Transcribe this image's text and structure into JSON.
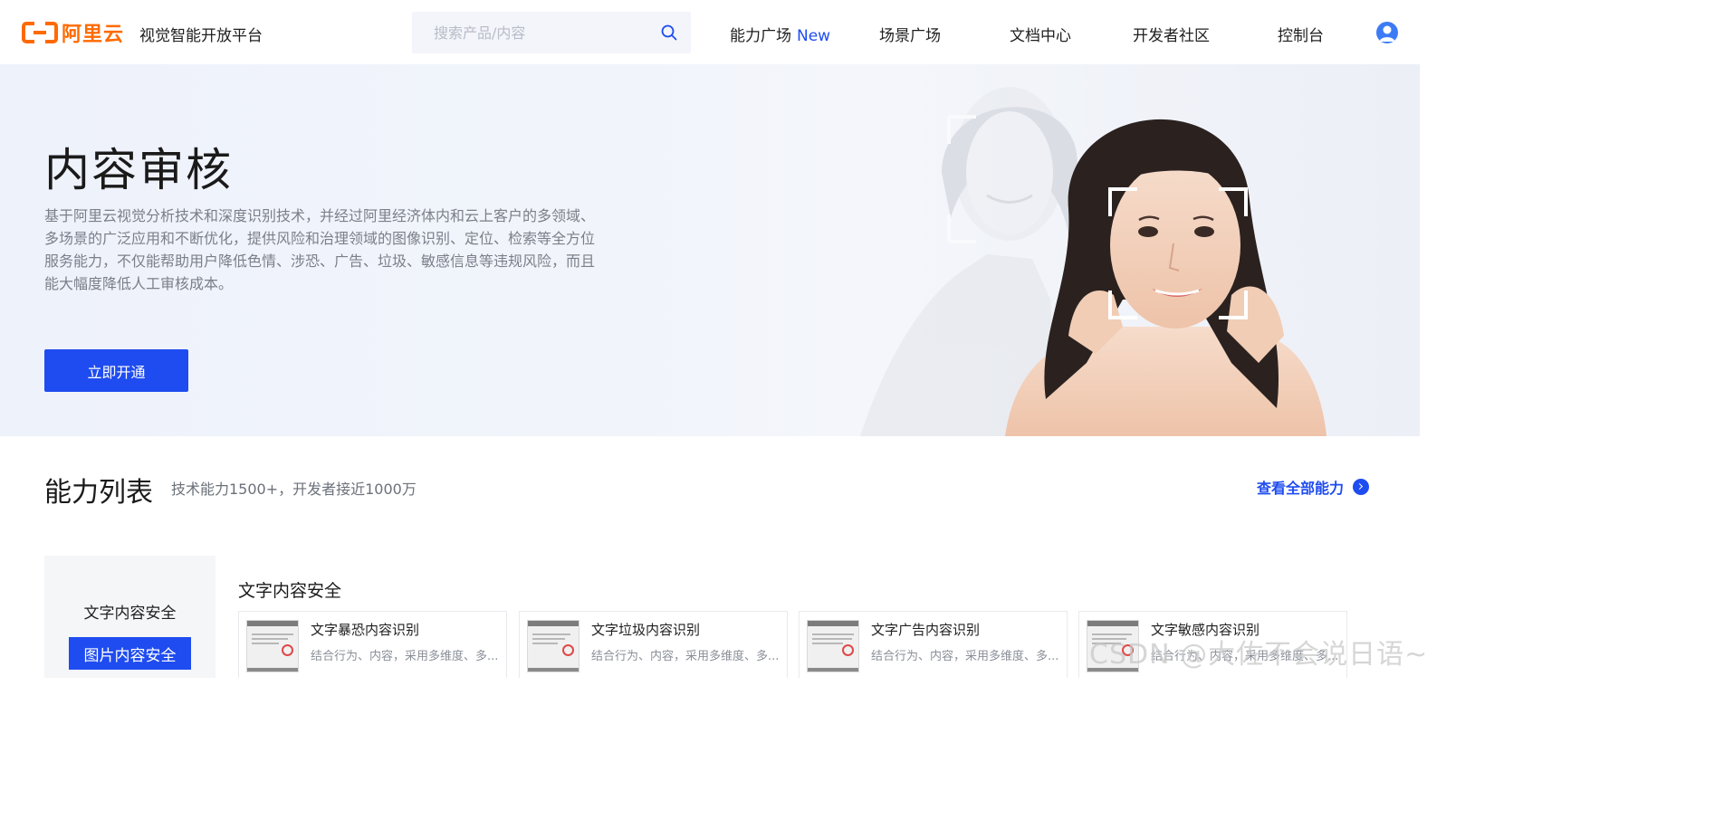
{
  "header": {
    "logo_text": "阿里云",
    "platform_name": "视觉智能开放平台",
    "search_placeholder": "搜索产品/内容",
    "nav": [
      {
        "label": "能力广场",
        "badge": "New"
      },
      {
        "label": "场景广场"
      },
      {
        "label": "文档中心"
      },
      {
        "label": "开发者社区"
      },
      {
        "label": "控制台"
      }
    ]
  },
  "hero": {
    "title": "内容审核",
    "description": "基于阿里云视觉分析技术和深度识别技术，并经过阿里经济体内和云上客户的多领域、多场景的广泛应用和不断优化，提供风险和治理领域的图像识别、定位、检索等全方位服务能力，不仅能帮助用户降低色情、涉恐、广告、垃圾、敏感信息等违规风险，而且能大幅度降低人工审核成本。",
    "button_label": "立即开通"
  },
  "ability": {
    "title": "能力列表",
    "subtitle": "技术能力1500+，开发者接近1000万",
    "view_all": "查看全部能力",
    "categories": [
      {
        "label": "文字内容安全",
        "active": false
      },
      {
        "label": "图片内容安全",
        "active": true
      }
    ],
    "section_title": "文字内容安全",
    "cards": [
      {
        "title": "文字暴恐内容识别",
        "desc": "结合行为、内容，采用多维度、多..."
      },
      {
        "title": "文字垃圾内容识别",
        "desc": "结合行为、内容，采用多维度、多..."
      },
      {
        "title": "文字广告内容识别",
        "desc": "结合行为、内容，采用多维度、多..."
      },
      {
        "title": "文字敏感内容识别",
        "desc": "结合行为、内容，采用多维度、多..."
      }
    ]
  },
  "watermark": "CSDN @大佐不会说日语~",
  "colors": {
    "brand_orange": "#ff6a00",
    "primary_blue": "#1f4cf0"
  }
}
